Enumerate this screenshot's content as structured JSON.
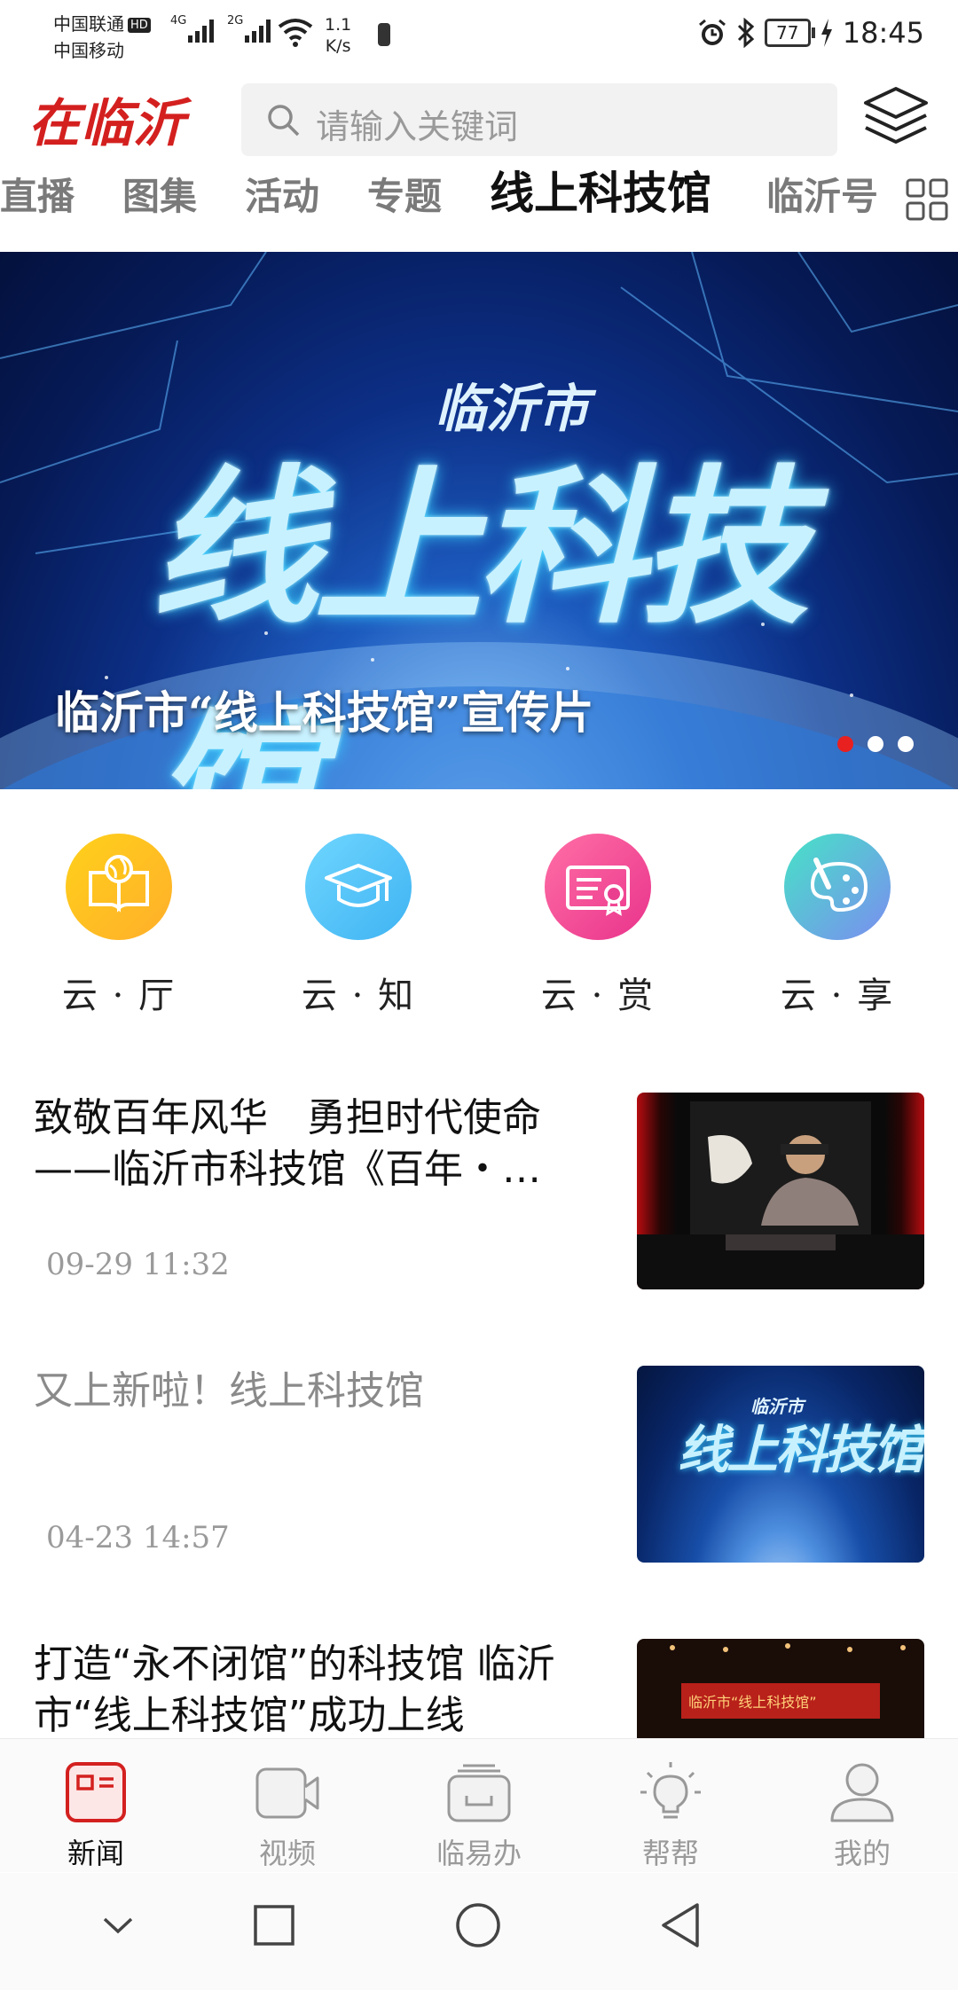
{
  "status_bar": {
    "carrier1": "中国联通",
    "hd": "HD",
    "carrier2": "中国移动",
    "sig1_label": "4G",
    "sig2_label": "2G",
    "speed": "1.1",
    "speed_unit": "K/s",
    "battery": "77",
    "time": "18:45"
  },
  "header": {
    "logo": "在临沂",
    "search_placeholder": "请输入关键词"
  },
  "tabs": [
    {
      "label": "直播",
      "active": false
    },
    {
      "label": "图集",
      "active": false
    },
    {
      "label": "活动",
      "active": false
    },
    {
      "label": "专题",
      "active": false
    },
    {
      "label": "线上科技馆",
      "active": true
    },
    {
      "label": "临沂号",
      "active": false
    }
  ],
  "banner": {
    "subtitle": "临沂市",
    "title": "线上科技馆",
    "caption": "临沂市“线上科技馆”宣传片",
    "dots": 3,
    "active_dot": 0
  },
  "categories": [
    {
      "label": "云 · 厅",
      "color_from": "#ffd11a",
      "color_to": "#ffae2b"
    },
    {
      "label": "云 · 知",
      "color_from": "#6fd6ff",
      "color_to": "#3fb3f2"
    },
    {
      "label": "云 · 赏",
      "color_from": "#ff6fa5",
      "color_to": "#e9338c"
    },
    {
      "label": "云 · 享",
      "color_from": "#46e3c6",
      "color_to": "#7b8df0"
    }
  ],
  "news": [
    {
      "title": "致敬百年风华　勇担时代使命——临沂市科技馆《百年・…",
      "time": "09-29  11:32",
      "read": false
    },
    {
      "title": "又上新啦！线上科技馆",
      "time": "04-23  14:57",
      "read": true
    },
    {
      "title": "打造“永不闭馆”的科技馆 临沂市“线上科技馆”成功上线",
      "time": "",
      "read": false
    }
  ],
  "thumbs": {
    "t2_sub": "临沂市",
    "t2_title": "线上科技馆",
    "t3_banner": "临沂市“线上科技馆”"
  },
  "bottom_nav": [
    {
      "label": "新闻",
      "active": true
    },
    {
      "label": "视频",
      "active": false
    },
    {
      "label": "临易办",
      "active": false
    },
    {
      "label": "帮帮",
      "active": false
    },
    {
      "label": "我的",
      "active": false
    }
  ],
  "colors": {
    "brand_red": "#d3201f",
    "accent_red": "#e82020"
  }
}
